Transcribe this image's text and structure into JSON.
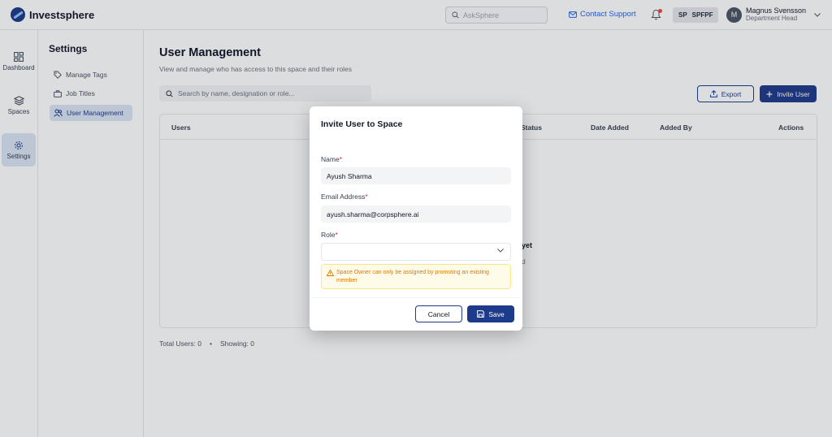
{
  "app": {
    "name": "Investsphere"
  },
  "topbar": {
    "search_placeholder": "AskSphere",
    "contact_label": "Contact Support",
    "space_initials": "SP",
    "space_name": "SPFPF",
    "user": {
      "initial": "M",
      "name": "Magnus Svensson",
      "role": "Department Head"
    }
  },
  "rail": {
    "items": [
      {
        "label": "Dashboard",
        "icon": "dashboard-icon",
        "active": false
      },
      {
        "label": "Spaces",
        "icon": "layers-icon",
        "active": false
      },
      {
        "label": "Settings",
        "icon": "gear-icon",
        "active": true
      }
    ]
  },
  "settings": {
    "title": "Settings",
    "items": [
      {
        "label": "Manage Tags",
        "icon": "tag-icon",
        "active": false
      },
      {
        "label": "Job Titles",
        "icon": "briefcase-icon",
        "active": false
      },
      {
        "label": "User Management",
        "icon": "users-icon",
        "active": true
      }
    ]
  },
  "main": {
    "title": "User Management",
    "subtitle": "View and manage  who has access to this space and their roles",
    "search_placeholder": "Search by name, designation or role...",
    "export_label": "Export",
    "invite_label": "Invite User",
    "columns": [
      "Users",
      "Status",
      "Date Added",
      "Added By",
      "Actions"
    ],
    "empty_title_fragment": "yet",
    "empty_sub_fragment": "d",
    "footer": {
      "total": "Total Users: 0",
      "separator": "•",
      "showing": "Showing: 0"
    }
  },
  "modal": {
    "title": "Invite User to Space",
    "name_label": "Name",
    "name_value": "Ayush Sharma",
    "email_label": "Email Address",
    "email_value": "ayush.sharma@corpsphere.ai",
    "role_label": "Role",
    "role_value": "",
    "required_mark": "*",
    "warning": "Space Owner can only be assigned by promoting an existing member",
    "cancel_label": "Cancel",
    "save_label": "Save"
  },
  "colors": {
    "primary": "#1e3a8a",
    "link": "#2563eb",
    "warning": "#d97706",
    "required": "#dc2626"
  }
}
